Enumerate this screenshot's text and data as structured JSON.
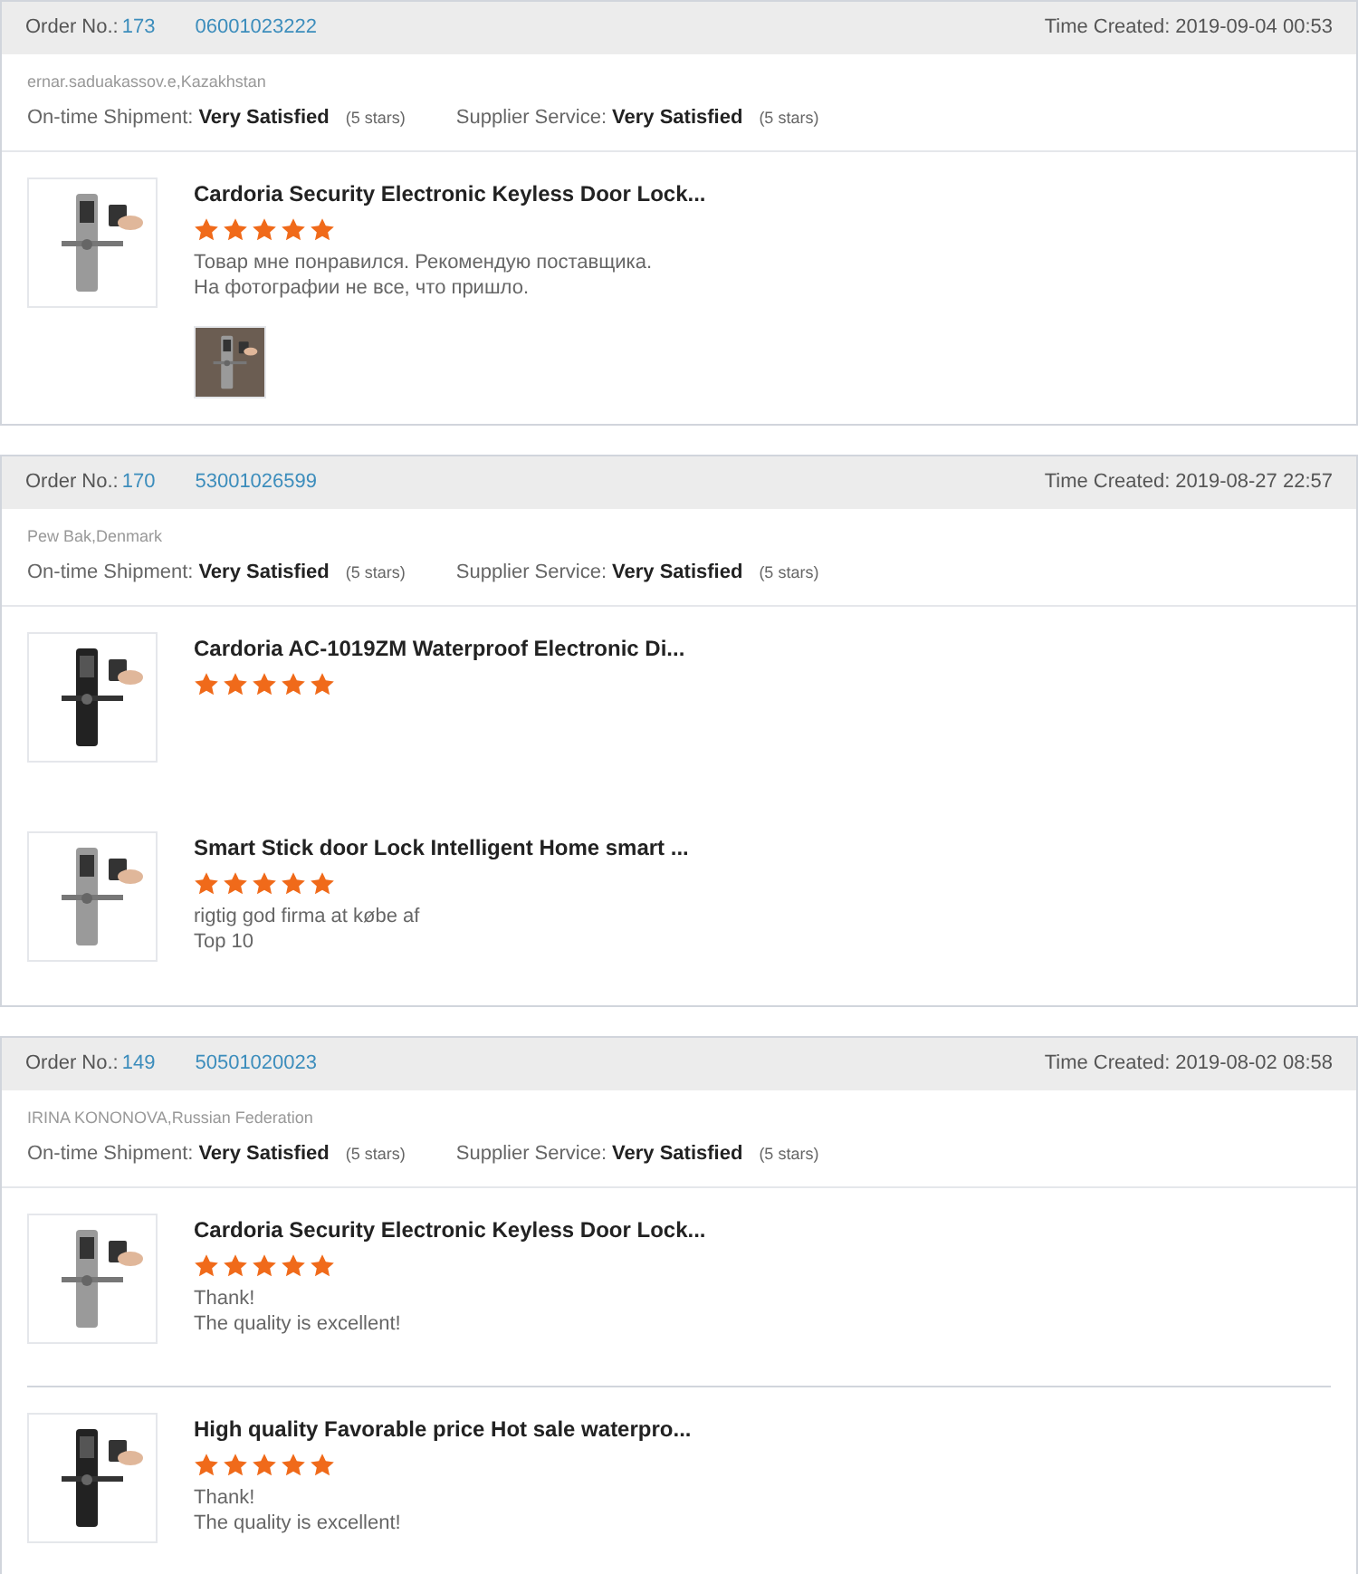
{
  "orders": [
    {
      "order_label": "Order No.:",
      "order_number": "173",
      "order_code": "06001023222",
      "time_label": "Time Created:",
      "time": "2019-09-04 00:53",
      "buyer": "ernar.saduakassov.e,Kazakhstan",
      "ratings": [
        {
          "label": "On-time Shipment:",
          "value": "Very Satisfied",
          "note": "(5 stars)"
        },
        {
          "label": "Supplier Service:",
          "value": "Very Satisfied",
          "note": "(5 stars)"
        }
      ],
      "items": [
        {
          "title": "Cardoria Security Electronic Keyless Door Lock...",
          "stars": 5,
          "review": [
            "Товар мне понравился. Рекомендую поставщика.",
            "На фотографии не все, что пришло."
          ],
          "photos": [
            {
              "kind": "picture"
            }
          ]
        }
      ]
    },
    {
      "order_label": "Order No.:",
      "order_number": "170",
      "order_code": "53001026599",
      "time_label": "Time Created:",
      "time": "2019-08-27 22:57",
      "buyer": "Pew Bak,Denmark",
      "ratings": [
        {
          "label": "On-time Shipment:",
          "value": "Very Satisfied",
          "note": "(5 stars)"
        },
        {
          "label": "Supplier Service:",
          "value": "Very Satisfied",
          "note": "(5 stars)"
        }
      ],
      "items": [
        {
          "title": "Cardoria AC-1019ZM Waterproof Electronic Di...",
          "stars": 5
        },
        {
          "title": "Smart Stick door Lock Intelligent Home smart ...",
          "stars": 5,
          "review": [
            "rigtig god firma at købe af",
            "Top 10"
          ]
        }
      ]
    },
    {
      "order_label": "Order No.:",
      "order_number": "149",
      "order_code": "50501020023",
      "time_label": "Time Created:",
      "time": "2019-08-02 08:58",
      "buyer": "IRINA KONONOVA,Russian Federation",
      "ratings": [
        {
          "label": "On-time Shipment:",
          "value": "Very Satisfied",
          "note": "(5 stars)"
        },
        {
          "label": "Supplier Service:",
          "value": "Very Satisfied",
          "note": "(5 stars)"
        }
      ],
      "items": [
        {
          "title": "Cardoria Security Electronic Keyless Door Lock...",
          "stars": 5,
          "review": [
            "Thank!",
            "The quality is excellent!"
          ]
        },
        {
          "title": "High quality Favorable price Hot sale waterpro...",
          "stars": 5,
          "review": [
            "Thank!",
            "The quality is excellent!"
          ]
        }
      ]
    }
  ]
}
